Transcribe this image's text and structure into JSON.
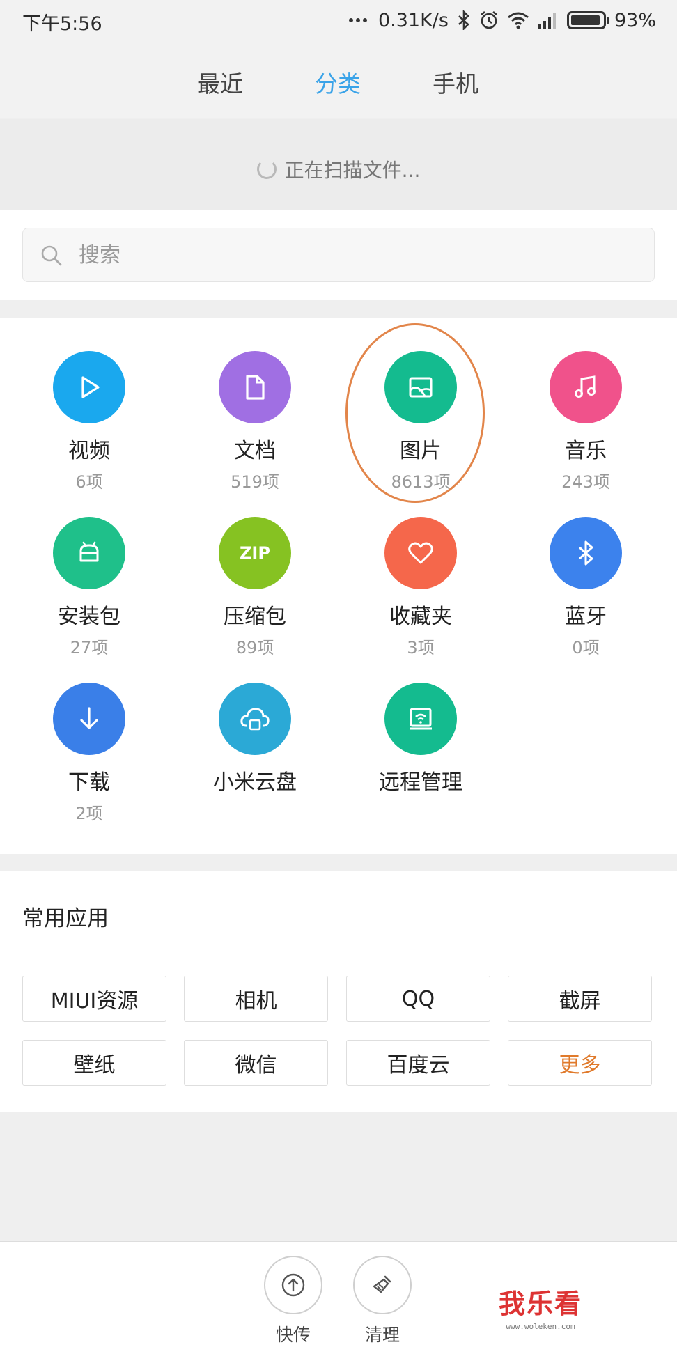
{
  "status": {
    "time": "下午5:56",
    "speed": "0.31K/s",
    "battery": "93%",
    "battery_level": 0.93
  },
  "tabs": [
    {
      "label": "最近",
      "active": false
    },
    {
      "label": "分类",
      "active": true
    },
    {
      "label": "手机",
      "active": false
    }
  ],
  "scanning": {
    "text": "正在扫描文件..."
  },
  "search": {
    "placeholder": "搜索",
    "value": ""
  },
  "categories": [
    {
      "name": "视频",
      "count": "6项",
      "icon": "play-icon",
      "color": "#1aa8ee"
    },
    {
      "name": "文档",
      "count": "519项",
      "icon": "document-icon",
      "color": "#a06fe3"
    },
    {
      "name": "图片",
      "count": "8613项",
      "icon": "image-icon",
      "color": "#14bb8f"
    },
    {
      "name": "音乐",
      "count": "243项",
      "icon": "music-icon",
      "color": "#f0528b"
    },
    {
      "name": "安装包",
      "count": "27项",
      "icon": "android-icon",
      "color": "#1fc08a"
    },
    {
      "name": "压缩包",
      "count": "89项",
      "icon": "zip-icon",
      "color": "#86c222",
      "icon_text": "ZIP"
    },
    {
      "name": "收藏夹",
      "count": "3项",
      "icon": "heart-icon",
      "color": "#f5674b"
    },
    {
      "name": "蓝牙",
      "count": "0项",
      "icon": "bluetooth-icon",
      "color": "#3c82ed"
    },
    {
      "name": "下载",
      "count": "2项",
      "icon": "download-icon",
      "color": "#3a7fe8"
    },
    {
      "name": "小米云盘",
      "count": "",
      "icon": "cloud-icon",
      "color": "#2ba9d6"
    },
    {
      "name": "远程管理",
      "count": "",
      "icon": "remote-icon",
      "color": "#14bb8f"
    }
  ],
  "apps": {
    "title": "常用应用",
    "items": [
      "MIUI资源",
      "相机",
      "QQ",
      "截屏",
      "壁纸",
      "微信",
      "百度云",
      "更多"
    ],
    "more_color": "#e07a2b"
  },
  "bottom": {
    "share_label": "快传",
    "clean_label": "清理"
  },
  "watermark": {
    "text": "我乐看",
    "sub": "www.woleken.com"
  }
}
